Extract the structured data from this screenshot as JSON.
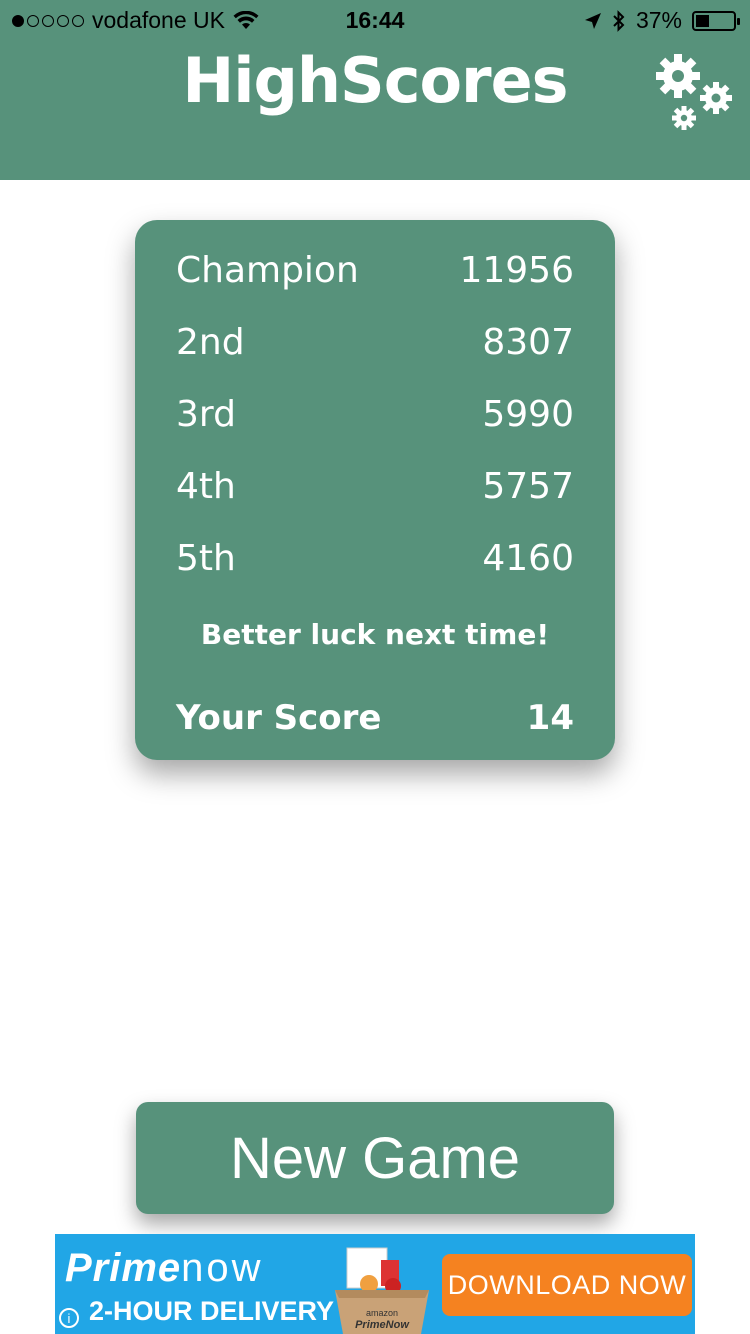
{
  "status_bar": {
    "carrier": "vodafone UK",
    "time": "16:44",
    "battery": "37%",
    "signal_strength": 1,
    "signal_max": 5
  },
  "header": {
    "title": "HighScores",
    "settings_icon": "gears-icon"
  },
  "scores": [
    {
      "label": "Champion",
      "value": "11956"
    },
    {
      "label": "2nd",
      "value": "8307"
    },
    {
      "label": "3rd",
      "value": "5990"
    },
    {
      "label": "4th",
      "value": "5757"
    },
    {
      "label": "5th",
      "value": "4160"
    }
  ],
  "message": "Better luck next time!",
  "your_score": {
    "label": "Your Score",
    "value": "14"
  },
  "new_game_label": "New Game",
  "ad": {
    "brand_prime": "Prime",
    "brand_now": "now",
    "tagline": "2-HOUR DELIVERY",
    "cta": "DOWNLOAD NOW",
    "box_text": "amazon PrimeNow"
  },
  "colors": {
    "primary": "#57927b",
    "ad_background": "#21a6e6",
    "ad_cta": "#f58220"
  }
}
